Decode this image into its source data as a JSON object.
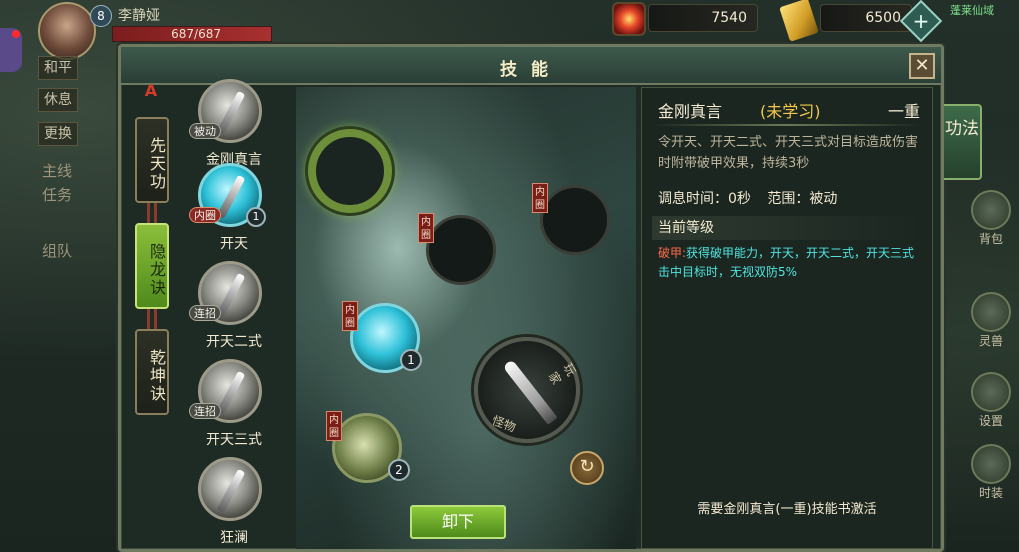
{
  "hud": {
    "player_level": "8",
    "player_name": "李静娅",
    "hp_text": "687/687",
    "left_tags": [
      "和平",
      "休息",
      "更换"
    ],
    "left_vertical": [
      "主线",
      "任务",
      "组队"
    ],
    "currency_gem": "7540",
    "currency_ticket": "6500",
    "plus_label": "+",
    "region": "蓬莱仙域",
    "right_menu": [
      "背包",
      "灵兽",
      "设置",
      "时装"
    ]
  },
  "panel": {
    "title": "技能",
    "close_label": "✕"
  },
  "categories": [
    {
      "label": "先天功",
      "active": false
    },
    {
      "label": "隐龙诀",
      "active": true
    },
    {
      "label": "乾坤诀",
      "active": false
    }
  ],
  "skills": [
    {
      "name": "金刚真言",
      "tag": "被动",
      "level": "",
      "style": "grey"
    },
    {
      "name": "开天",
      "tag": "内圈",
      "level": "1",
      "style": "cyan"
    },
    {
      "name": "开天二式",
      "tag": "连招",
      "level": "",
      "style": "grey"
    },
    {
      "name": "开天三式",
      "tag": "连招",
      "level": "",
      "style": "grey"
    },
    {
      "name": "狂澜",
      "tag": "",
      "level": "",
      "style": "grey"
    }
  ],
  "slots": {
    "inner_tag": "内圈",
    "filled_level": "1",
    "fist_level": "2",
    "wheel_top": "玩家",
    "wheel_bottom": "怪物",
    "refresh_label": "↻",
    "unequip_label": "卸下"
  },
  "detail": {
    "name": "金刚真言",
    "status": "(未学习)",
    "rank": "一重",
    "description": "令开天、开天二式、开天三式对目标造成伤害时附带破甲效果，持续3秒",
    "cooldown": "调息时间：0秒",
    "range": "范围：被动",
    "current_level_label": "当前等级",
    "effect_prefix": "破甲:",
    "effect_text": "获得破甲能力，开天，开天二式，开天三式击中目标时，无视双防5%",
    "footer": "需要金刚真言(一重)技能书激活"
  },
  "side_tab": "功法",
  "colors": {
    "accent_green": "#8dc93a",
    "effect_cyan": "#4fe4e0",
    "status_gold": "#f4c84a"
  }
}
